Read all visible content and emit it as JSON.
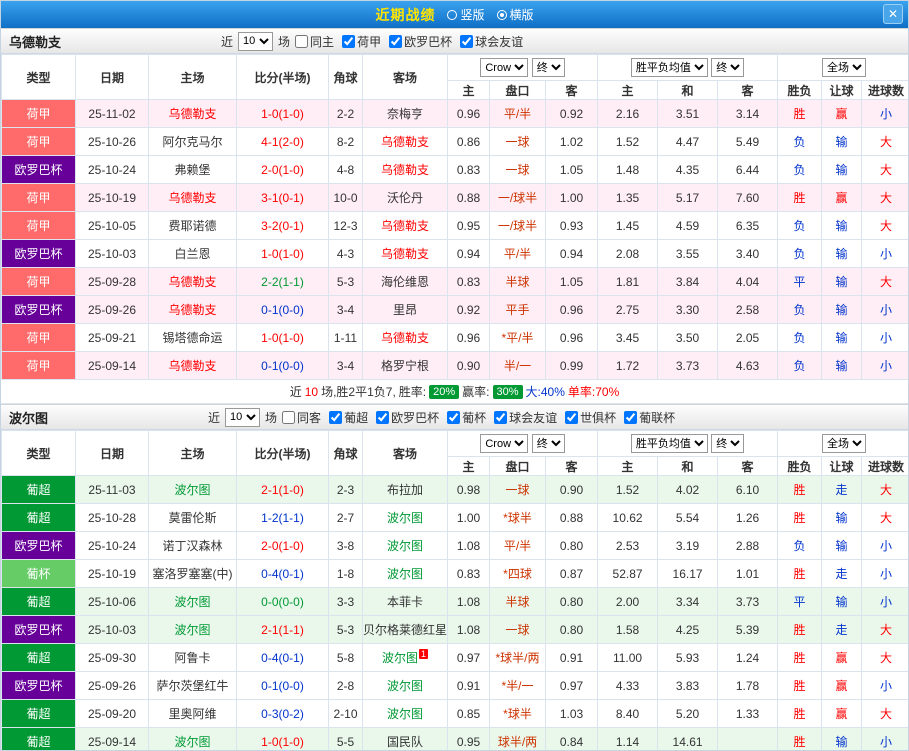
{
  "topbar": {
    "title": "近期战绩",
    "radios": [
      {
        "label": "竖版",
        "selected": false
      },
      {
        "label": "横版",
        "selected": true
      }
    ],
    "close": "✕"
  },
  "colors": {
    "r": "#ff0000",
    "g": "#009933",
    "b": "#0033cc",
    "handicap": "#cc3300"
  },
  "columns": {
    "type": "类型",
    "date": "日期",
    "home": "主场",
    "score": "比分(半场)",
    "corner": "角球",
    "away": "客场",
    "company": "Crow",
    "final": "终",
    "avg": "胜平负均值",
    "scope": "全场",
    "h": "主",
    "handicap": "盘口",
    "a": "客",
    "win": "主",
    "draw": "和",
    "lose": "客",
    "result": "胜负",
    "let": "让球",
    "goals": "进球数"
  },
  "sections": [
    {
      "team": "乌德勒支",
      "team_color": "#ff0000",
      "highlight_color": "#ffeef5",
      "filter": {
        "near": "近",
        "count": "10",
        "unit": "场",
        "checks": [
          {
            "label": "同主",
            "checked": false
          },
          {
            "label": "荷甲",
            "checked": true
          },
          {
            "label": "欧罗巴杯",
            "checked": true
          },
          {
            "label": "球会友谊",
            "checked": true
          }
        ]
      },
      "rows": [
        {
          "lg": "荷甲",
          "lgc": "#ff6a6a",
          "date": "25-11-02",
          "home": "乌德勒支",
          "hf": true,
          "score": "1-0(1-0)",
          "sc": "r",
          "cor": "2-2",
          "away": "奈梅亨",
          "af": false,
          "o": [
            "0.96",
            "平/半",
            "0.92",
            "2.16",
            "3.51",
            "3.14"
          ],
          "res": [
            "胜",
            "r"
          ],
          "rang": [
            "赢",
            "r"
          ],
          "big": [
            "小",
            "b"
          ],
          "hl": true
        },
        {
          "lg": "荷甲",
          "lgc": "#ff6a6a",
          "date": "25-10-26",
          "home": "阿尔克马尔",
          "hf": false,
          "score": "4-1(2-0)",
          "sc": "r",
          "cor": "8-2",
          "away": "乌德勒支",
          "af": true,
          "o": [
            "0.86",
            "一球",
            "1.02",
            "1.52",
            "4.47",
            "5.49"
          ],
          "res": [
            "负",
            "b"
          ],
          "rang": [
            "输",
            "b"
          ],
          "big": [
            "大",
            "r"
          ],
          "hl": false
        },
        {
          "lg": "欧罗巴杯",
          "lgc": "#660099",
          "date": "25-10-24",
          "home": "弗赖堡",
          "hf": false,
          "score": "2-0(1-0)",
          "sc": "r",
          "cor": "4-8",
          "away": "乌德勒支",
          "af": true,
          "o": [
            "0.83",
            "一球",
            "1.05",
            "1.48",
            "4.35",
            "6.44"
          ],
          "res": [
            "负",
            "b"
          ],
          "rang": [
            "输",
            "b"
          ],
          "big": [
            "大",
            "r"
          ],
          "hl": false
        },
        {
          "lg": "荷甲",
          "lgc": "#ff6a6a",
          "date": "25-10-19",
          "home": "乌德勒支",
          "hf": true,
          "score": "3-1(0-1)",
          "sc": "r",
          "cor": "10-0",
          "away": "沃伦丹",
          "af": false,
          "o": [
            "0.88",
            "一/球半",
            "1.00",
            "1.35",
            "5.17",
            "7.60"
          ],
          "res": [
            "胜",
            "r"
          ],
          "rang": [
            "赢",
            "r"
          ],
          "big": [
            "大",
            "r"
          ],
          "hl": true
        },
        {
          "lg": "荷甲",
          "lgc": "#ff6a6a",
          "date": "25-10-05",
          "home": "费耶诺德",
          "hf": false,
          "score": "3-2(0-1)",
          "sc": "r",
          "cor": "12-3",
          "away": "乌德勒支",
          "af": true,
          "o": [
            "0.95",
            "一/球半",
            "0.93",
            "1.45",
            "4.59",
            "6.35"
          ],
          "res": [
            "负",
            "b"
          ],
          "rang": [
            "输",
            "b"
          ],
          "big": [
            "大",
            "r"
          ],
          "hl": false
        },
        {
          "lg": "欧罗巴杯",
          "lgc": "#660099",
          "date": "25-10-03",
          "home": "白兰恩",
          "hf": false,
          "score": "1-0(1-0)",
          "sc": "r",
          "cor": "4-3",
          "away": "乌德勒支",
          "af": true,
          "o": [
            "0.94",
            "平/半",
            "0.94",
            "2.08",
            "3.55",
            "3.40"
          ],
          "res": [
            "负",
            "b"
          ],
          "rang": [
            "输",
            "b"
          ],
          "big": [
            "小",
            "b"
          ],
          "hl": false
        },
        {
          "lg": "荷甲",
          "lgc": "#ff6a6a",
          "date": "25-09-28",
          "home": "乌德勒支",
          "hf": true,
          "score": "2-2(1-1)",
          "sc": "g",
          "cor": "5-3",
          "away": "海伦维恩",
          "af": false,
          "o": [
            "0.83",
            "半球",
            "1.05",
            "1.81",
            "3.84",
            "4.04"
          ],
          "res": [
            "平",
            "b"
          ],
          "rang": [
            "输",
            "b"
          ],
          "big": [
            "大",
            "r"
          ],
          "hl": true
        },
        {
          "lg": "欧罗巴杯",
          "lgc": "#660099",
          "date": "25-09-26",
          "home": "乌德勒支",
          "hf": true,
          "score": "0-1(0-0)",
          "sc": "b",
          "cor": "3-4",
          "away": "里昂",
          "af": false,
          "o": [
            "0.92",
            "平手",
            "0.96",
            "2.75",
            "3.30",
            "2.58"
          ],
          "res": [
            "负",
            "b"
          ],
          "rang": [
            "输",
            "b"
          ],
          "big": [
            "小",
            "b"
          ],
          "hl": true
        },
        {
          "lg": "荷甲",
          "lgc": "#ff6a6a",
          "date": "25-09-21",
          "home": "锡塔德命运",
          "hf": false,
          "score": "1-0(1-0)",
          "sc": "r",
          "cor": "1-11",
          "away": "乌德勒支",
          "af": true,
          "o": [
            "0.96",
            "*平/半",
            "0.96",
            "3.45",
            "3.50",
            "2.05"
          ],
          "res": [
            "负",
            "b"
          ],
          "rang": [
            "输",
            "b"
          ],
          "big": [
            "小",
            "b"
          ],
          "hl": false
        },
        {
          "lg": "荷甲",
          "lgc": "#ff6a6a",
          "date": "25-09-14",
          "home": "乌德勒支",
          "hf": true,
          "score": "0-1(0-0)",
          "sc": "b",
          "cor": "3-4",
          "away": "格罗宁根",
          "af": false,
          "o": [
            "0.90",
            "半/一",
            "0.99",
            "1.72",
            "3.73",
            "4.63"
          ],
          "res": [
            "负",
            "b"
          ],
          "rang": [
            "输",
            "b"
          ],
          "big": [
            "小",
            "b"
          ],
          "hl": true
        }
      ],
      "summary": [
        {
          "t": "近"
        },
        {
          "t": "10",
          "c": "r"
        },
        {
          "t": "场,胜2平1负7,"
        },
        {
          "t": "胜率:"
        },
        {
          "t": "20%",
          "chip": true
        },
        {
          "t": "赢率:"
        },
        {
          "t": "30%",
          "chip": true
        },
        {
          "t": "大:40%",
          "c": "b"
        },
        {
          "t": "单率:70%",
          "c": "r"
        }
      ]
    },
    {
      "team": "波尔图",
      "team_color": "#009933",
      "highlight_color": "#eaf8ec",
      "filter": {
        "near": "近",
        "count": "10",
        "unit": "场",
        "checks": [
          {
            "label": "同客",
            "checked": false
          },
          {
            "label": "葡超",
            "checked": true
          },
          {
            "label": "欧罗巴杯",
            "checked": true
          },
          {
            "label": "葡杯",
            "checked": true
          },
          {
            "label": "球会友谊",
            "checked": true
          },
          {
            "label": "世俱杯",
            "checked": true
          },
          {
            "label": "葡联杯",
            "checked": true
          }
        ]
      },
      "rows": [
        {
          "lg": "葡超",
          "lgc": "#009933",
          "date": "25-11-03",
          "home": "波尔图",
          "hf": true,
          "score": "2-1(1-0)",
          "sc": "r",
          "cor": "2-3",
          "away": "布拉加",
          "af": false,
          "o": [
            "0.98",
            "一球",
            "0.90",
            "1.52",
            "4.02",
            "6.10"
          ],
          "res": [
            "胜",
            "r"
          ],
          "rang": [
            "走",
            "b"
          ],
          "big": [
            "大",
            "r"
          ],
          "hl": true
        },
        {
          "lg": "葡超",
          "lgc": "#009933",
          "date": "25-10-28",
          "home": "莫雷伦斯",
          "hf": false,
          "score": "1-2(1-1)",
          "sc": "b",
          "cor": "2-7",
          "away": "波尔图",
          "af": true,
          "o": [
            "1.00",
            "*球半",
            "0.88",
            "10.62",
            "5.54",
            "1.26"
          ],
          "res": [
            "胜",
            "r"
          ],
          "rang": [
            "输",
            "b"
          ],
          "big": [
            "大",
            "r"
          ],
          "hl": false
        },
        {
          "lg": "欧罗巴杯",
          "lgc": "#660099",
          "date": "25-10-24",
          "home": "诺丁汉森林",
          "hf": false,
          "score": "2-0(1-0)",
          "sc": "r",
          "cor": "3-8",
          "away": "波尔图",
          "af": true,
          "o": [
            "1.08",
            "平/半",
            "0.80",
            "2.53",
            "3.19",
            "2.88"
          ],
          "res": [
            "负",
            "b"
          ],
          "rang": [
            "输",
            "b"
          ],
          "big": [
            "小",
            "b"
          ],
          "hl": false
        },
        {
          "lg": "葡杯",
          "lgc": "#66cc66",
          "date": "25-10-19",
          "home": "塞洛罗塞塞(中)",
          "hf": false,
          "score": "0-4(0-1)",
          "sc": "b",
          "cor": "1-8",
          "away": "波尔图",
          "af": true,
          "o": [
            "0.83",
            "*四球",
            "0.87",
            "52.87",
            "16.17",
            "1.01"
          ],
          "res": [
            "胜",
            "r"
          ],
          "rang": [
            "走",
            "b"
          ],
          "big": [
            "小",
            "b"
          ],
          "hl": false
        },
        {
          "lg": "葡超",
          "lgc": "#009933",
          "date": "25-10-06",
          "home": "波尔图",
          "hf": true,
          "score": "0-0(0-0)",
          "sc": "g",
          "cor": "3-3",
          "away": "本菲卡",
          "af": false,
          "o": [
            "1.08",
            "半球",
            "0.80",
            "2.00",
            "3.34",
            "3.73"
          ],
          "res": [
            "平",
            "b"
          ],
          "rang": [
            "输",
            "b"
          ],
          "big": [
            "小",
            "b"
          ],
          "hl": true
        },
        {
          "lg": "欧罗巴杯",
          "lgc": "#660099",
          "date": "25-10-03",
          "home": "波尔图",
          "hf": true,
          "score": "2-1(1-1)",
          "sc": "r",
          "cor": "5-3",
          "away": "贝尔格莱德红星",
          "af": false,
          "o": [
            "1.08",
            "一球",
            "0.80",
            "1.58",
            "4.25",
            "5.39"
          ],
          "res": [
            "胜",
            "r"
          ],
          "rang": [
            "走",
            "b"
          ],
          "big": [
            "大",
            "r"
          ],
          "hl": true
        },
        {
          "lg": "葡超",
          "lgc": "#009933",
          "date": "25-09-30",
          "home": "阿鲁卡",
          "hf": false,
          "score": "0-4(0-1)",
          "sc": "b",
          "cor": "5-8",
          "away": "波尔图",
          "af": true,
          "badge": "1",
          "o": [
            "0.97",
            "*球半/两",
            "0.91",
            "11.00",
            "5.93",
            "1.24"
          ],
          "res": [
            "胜",
            "r"
          ],
          "rang": [
            "赢",
            "r"
          ],
          "big": [
            "大",
            "r"
          ],
          "hl": false
        },
        {
          "lg": "欧罗巴杯",
          "lgc": "#660099",
          "date": "25-09-26",
          "home": "萨尔茨堡红牛",
          "hf": false,
          "score": "0-1(0-0)",
          "sc": "b",
          "cor": "2-8",
          "away": "波尔图",
          "af": true,
          "o": [
            "0.91",
            "*半/一",
            "0.97",
            "4.33",
            "3.83",
            "1.78"
          ],
          "res": [
            "胜",
            "r"
          ],
          "rang": [
            "赢",
            "r"
          ],
          "big": [
            "小",
            "b"
          ],
          "hl": false
        },
        {
          "lg": "葡超",
          "lgc": "#009933",
          "date": "25-09-20",
          "home": "里奥阿维",
          "hf": false,
          "score": "0-3(0-2)",
          "sc": "b",
          "cor": "2-10",
          "away": "波尔图",
          "af": true,
          "o": [
            "0.85",
            "*球半",
            "1.03",
            "8.40",
            "5.20",
            "1.33"
          ],
          "res": [
            "胜",
            "r"
          ],
          "rang": [
            "赢",
            "r"
          ],
          "big": [
            "大",
            "r"
          ],
          "hl": false
        },
        {
          "lg": "葡超",
          "lgc": "#009933",
          "date": "25-09-14",
          "home": "波尔图",
          "hf": true,
          "score": "1-0(1-0)",
          "sc": "r",
          "cor": "5-5",
          "away": "国民队",
          "af": false,
          "o": [
            "0.95",
            "球半/两",
            "0.84",
            "1.14",
            "14.61",
            ""
          ],
          "res": [
            "胜",
            "r"
          ],
          "rang": [
            "输",
            "b"
          ],
          "big": [
            "小",
            "b"
          ],
          "hl": true
        }
      ]
    }
  ]
}
